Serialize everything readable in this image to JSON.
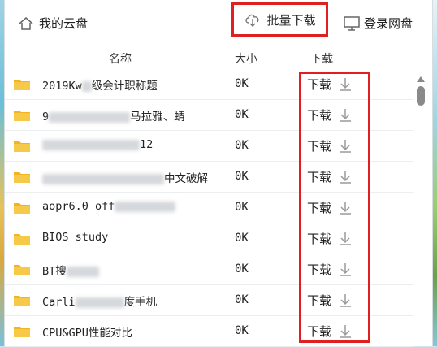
{
  "topbar": {
    "home_label": "我的云盘",
    "batch_label": "批量下载",
    "login_label": "登录网盘"
  },
  "columns": {
    "name": "名称",
    "size": "大小",
    "download": "下载"
  },
  "rows": [
    {
      "name": "2019Kw",
      "name_tail": "级会计职称题",
      "size": "0K",
      "dl": "下载"
    },
    {
      "name": "9",
      "name_tail": "马拉雅、蜻",
      "size": "0K",
      "dl": "下载"
    },
    {
      "name": "",
      "name_tail": "12",
      "size": "0K",
      "dl": "下载"
    },
    {
      "name": "",
      "name_tail": "中文破解",
      "size": "0K",
      "dl": "下载"
    },
    {
      "name": "aopr6.0 off",
      "name_tail": "",
      "size": "0K",
      "dl": "下载"
    },
    {
      "name": "BIOS study",
      "name_tail": "",
      "size": "0K",
      "dl": "下载"
    },
    {
      "name": "BT搜",
      "name_tail": "",
      "size": "0K",
      "dl": "下载"
    },
    {
      "name": "Carli",
      "name_tail": "度手机",
      "size": "0K",
      "dl": "下载"
    },
    {
      "name": "CPU&GPU性能对比",
      "name_tail": "",
      "size": "0K",
      "dl": "下载"
    }
  ]
}
